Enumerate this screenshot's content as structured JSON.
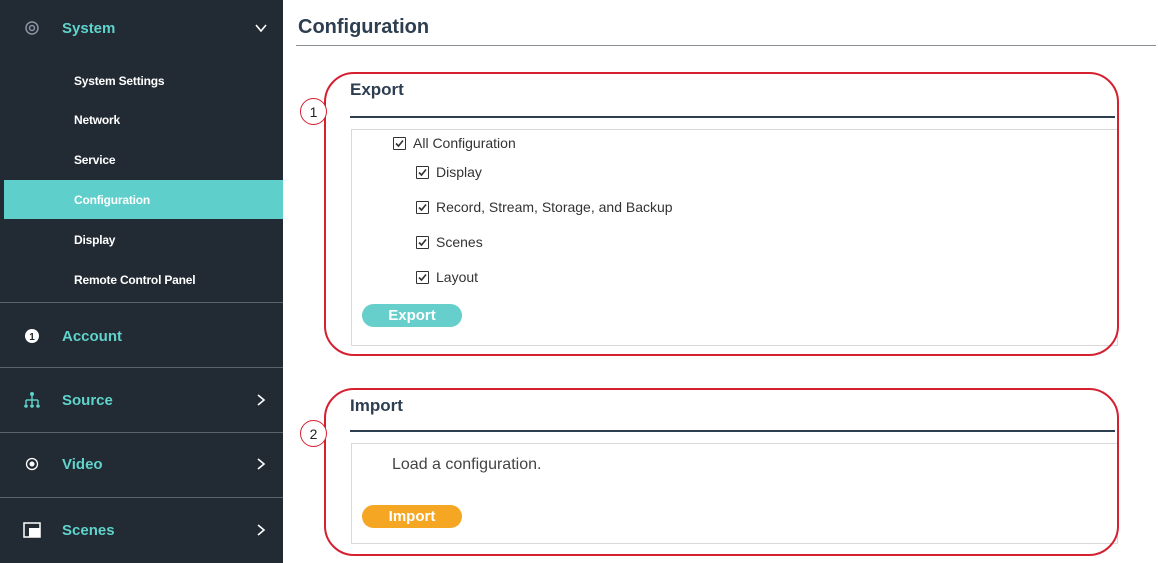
{
  "sidebar": {
    "system": {
      "label": "System",
      "icon": "gear-icon"
    },
    "items": [
      {
        "label": "System Settings",
        "active": false
      },
      {
        "label": "Network",
        "active": false
      },
      {
        "label": "Service",
        "active": false
      },
      {
        "label": "Configuration",
        "active": true
      },
      {
        "label": "Display",
        "active": false
      },
      {
        "label": "Remote Control Panel",
        "active": false
      }
    ],
    "account": {
      "label": "Account",
      "icon": "account-icon"
    },
    "source": {
      "label": "Source",
      "icon": "network-tree-icon"
    },
    "video": {
      "label": "Video",
      "icon": "radio-dot-icon"
    },
    "scenes": {
      "label": "Scenes",
      "icon": "scenes-icon"
    },
    "colors": {
      "background": "#222a33",
      "accent": "#5fd3cc",
      "active_bg": "#5fcfcb"
    }
  },
  "main": {
    "title": "Configuration",
    "export": {
      "title": "Export",
      "callout_number": "1",
      "all_label": "All Configuration",
      "options": [
        "Display",
        "Record, Stream, Storage, and Backup",
        "Scenes",
        "Layout"
      ],
      "button_label": "Export"
    },
    "import": {
      "title": "Import",
      "callout_number": "2",
      "text": "Load a configuration.",
      "button_label": "Import"
    },
    "colors": {
      "export_button": "#66cfcc",
      "import_button": "#f5a623",
      "callout": "#d61f2f"
    }
  }
}
